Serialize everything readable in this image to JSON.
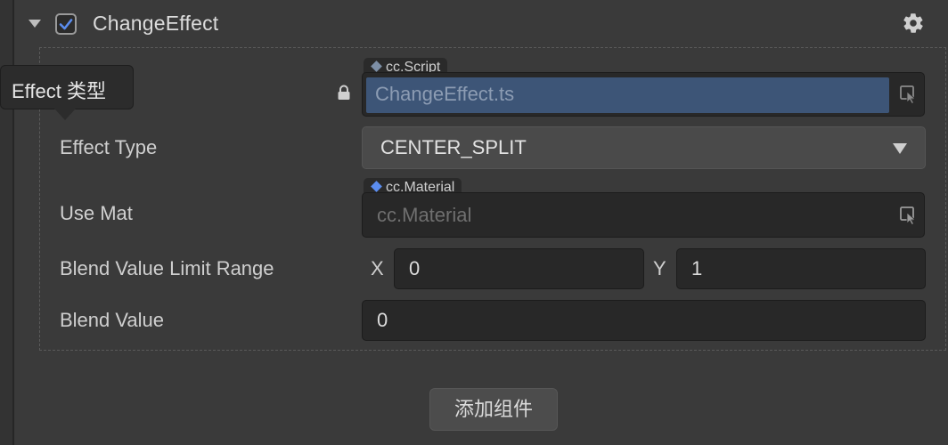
{
  "component": {
    "title": "ChangeEffect",
    "enabled": true,
    "expanded": true
  },
  "tooltip": {
    "text": "Effect 类型"
  },
  "properties": {
    "script": {
      "type_tag": "cc.Script",
      "value": "ChangeEffect.ts",
      "locked": true
    },
    "effect_type": {
      "label": "Effect Type",
      "value": "CENTER_SPLIT"
    },
    "use_mat": {
      "label": "Use Mat",
      "type_tag": "cc.Material",
      "placeholder": "cc.Material"
    },
    "blend_value_limit_range": {
      "label": "Blend Value Limit Range",
      "x_label": "X",
      "x_value": "0",
      "y_label": "Y",
      "y_value": "1"
    },
    "blend_value": {
      "label": "Blend Value",
      "value": "0"
    }
  },
  "footer": {
    "add_component_label": "添加组件"
  },
  "colors": {
    "panel_bg": "#3a3a3a",
    "field_bg": "#282828",
    "script_highlight": "#3d5577",
    "checkbox_check": "#5b8def",
    "type_dot": "#5b8def"
  },
  "icons": {
    "collapse": "chevron-down-icon",
    "checkbox": "checkbox-checked-icon",
    "settings": "gear-icon",
    "lock": "lock-icon",
    "pick": "pick-node-icon",
    "dropdown": "dropdown-arrow-icon"
  }
}
